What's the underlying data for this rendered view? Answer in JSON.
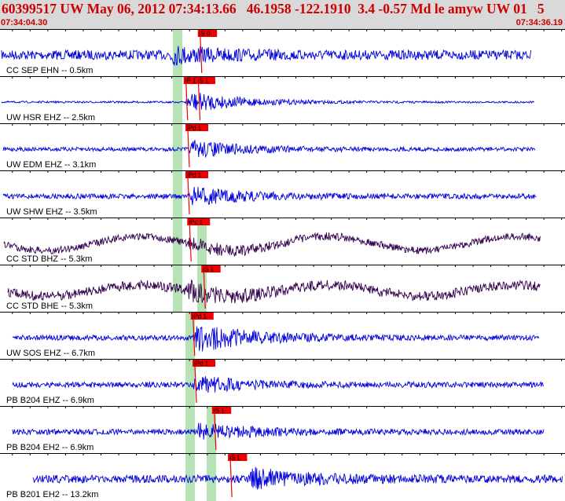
{
  "header": {
    "title": "60399517 UW May 06, 2012 07:34:13.66   46.1958 -122.1910  3.4 -0.57 Md le amyw UW 01   5",
    "start_time": "07:34:04.30",
    "end_time": "07:34:36.19"
  },
  "colors": {
    "header_bg": "#d9d9d9",
    "header_text": "#cc0000",
    "trace_blue": "#0000dd",
    "trace_dark": "#33004d",
    "pick_red": "#ee0000",
    "window_green": "#b6e3b6",
    "axis": "#000000"
  },
  "chart_data": {
    "type": "seismogram",
    "title": "60399517 UW May 06, 2012 07:34:13.66   46.1958 -122.1910  3.4 -0.57 Md le amyw UW 01   5",
    "x_range_time": [
      "07:34:04.30",
      "07:34:36.19"
    ],
    "traces": [
      {
        "label": "CC SEP EHN -- 0.5km",
        "picks": [
          {
            "label": "iS 0",
            "time": "07:34:15.6"
          }
        ],
        "color": "blue"
      },
      {
        "label": "UW HSR EHZ -- 2.5km",
        "picks": [
          {
            "label": "iP 1",
            "time": "07:34:14.8"
          },
          {
            "label": "iS 1",
            "time": "07:34:15.5"
          }
        ],
        "color": "blue"
      },
      {
        "label": "UW EDM EHZ -- 3.1km",
        "picks": [
          {
            "label": "iPd 1",
            "time": "07:34:14.9"
          }
        ],
        "color": "blue"
      },
      {
        "label": "UW SHW EHZ -- 3.5km",
        "picks": [
          {
            "label": "iPd 1",
            "time": "07:34:14.9"
          }
        ],
        "color": "blue"
      },
      {
        "label": "CC STD BHZ -- 5.3km",
        "picks": [
          {
            "label": "iPc 1",
            "time": "07:34:15.0"
          }
        ],
        "color": "dark"
      },
      {
        "label": "CC STD BHE -- 5.3km",
        "picks": [
          {
            "label": "iS 1",
            "time": "07:34:15.8"
          }
        ],
        "color": "dark"
      },
      {
        "label": "UW SOS EHZ -- 6.7km",
        "picks": [
          {
            "label": "iPd 1",
            "time": "07:34:15.2"
          }
        ],
        "color": "blue"
      },
      {
        "label": "PB B204 EHZ -- 6.9km",
        "picks": [
          {
            "label": "iPd 1",
            "time": "07:34:15.3"
          }
        ],
        "color": "blue"
      },
      {
        "label": "PB B204 EH2 -- 6.9km",
        "picks": [
          {
            "label": "iS 1",
            "time": "07:34:16.4"
          }
        ],
        "color": "blue"
      },
      {
        "label": "PB B201 EH2 -- 13.2km",
        "picks": [
          {
            "label": "iS 1",
            "time": "07:34:17.3"
          }
        ],
        "color": "blue"
      }
    ]
  }
}
